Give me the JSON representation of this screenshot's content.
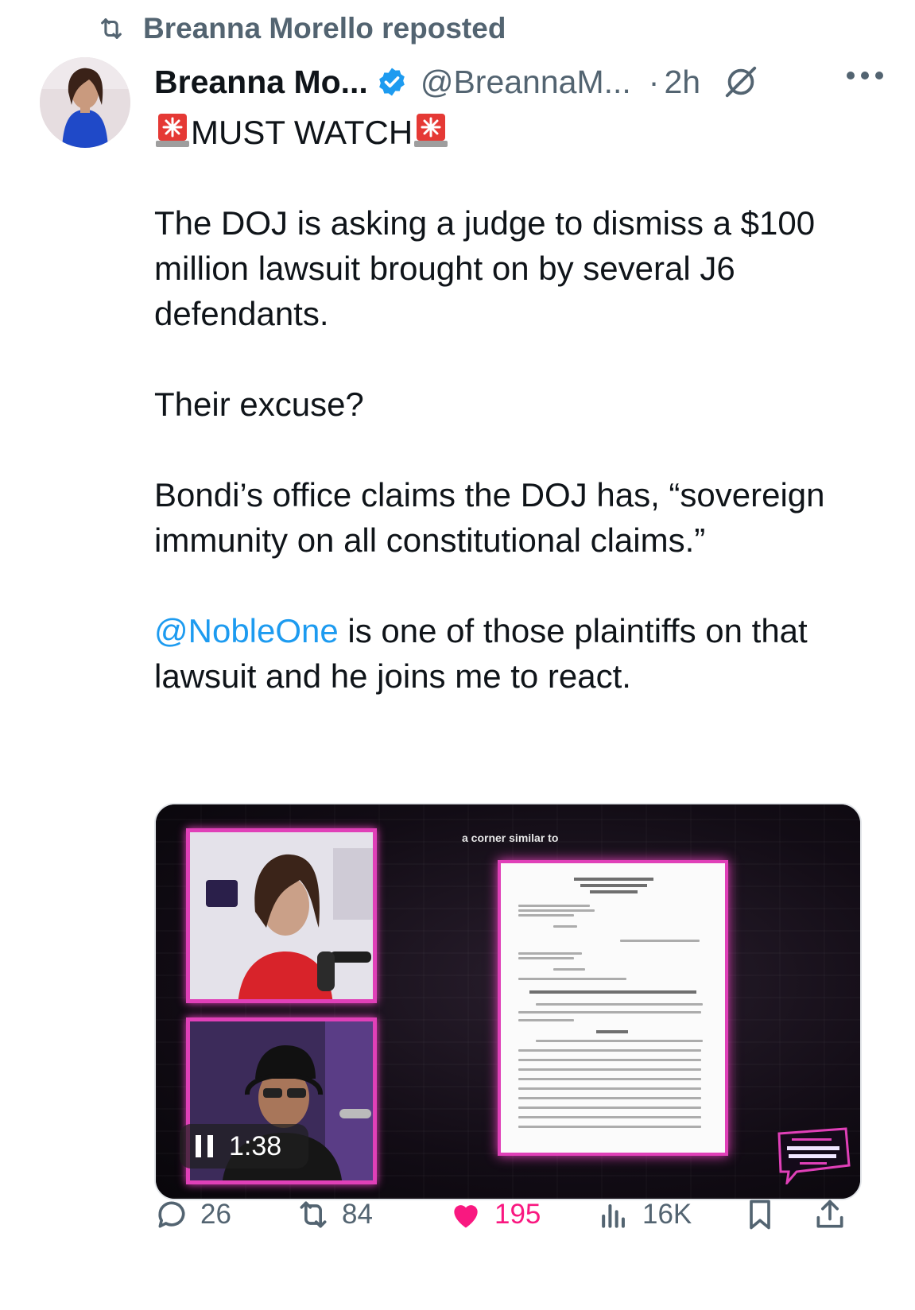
{
  "repost_bar": {
    "label": "Breanna Morello reposted",
    "icon": "repost-icon"
  },
  "author": {
    "display_name": "Breanna Mo...",
    "handle": "@BreannaM...",
    "verified": true,
    "separator": "·",
    "timestamp": "2h"
  },
  "tweet": {
    "headline": "MUST WATCH",
    "paragraphs": [
      "The DOJ is asking a judge to dismiss a $100 million lawsuit brought on by several J6 defendants.",
      "Their excuse?",
      "Bondi’s office claims the DOJ has, “sovereign immunity on all constitutional claims.”"
    ],
    "mention": "@NobleOne",
    "last_paragraph_rest": " is one of those plaintiffs on that lawsuit and he joins me to react."
  },
  "media": {
    "caption": "a corner similar to",
    "elapsed": "1:38"
  },
  "actions": {
    "replies": "26",
    "reposts": "84",
    "likes": "195",
    "views": "16K"
  },
  "colors": {
    "accent_blue": "#1d9bf0",
    "like_pink": "#f91880",
    "muted": "#536471",
    "frame_magenta": "#e040b8"
  }
}
